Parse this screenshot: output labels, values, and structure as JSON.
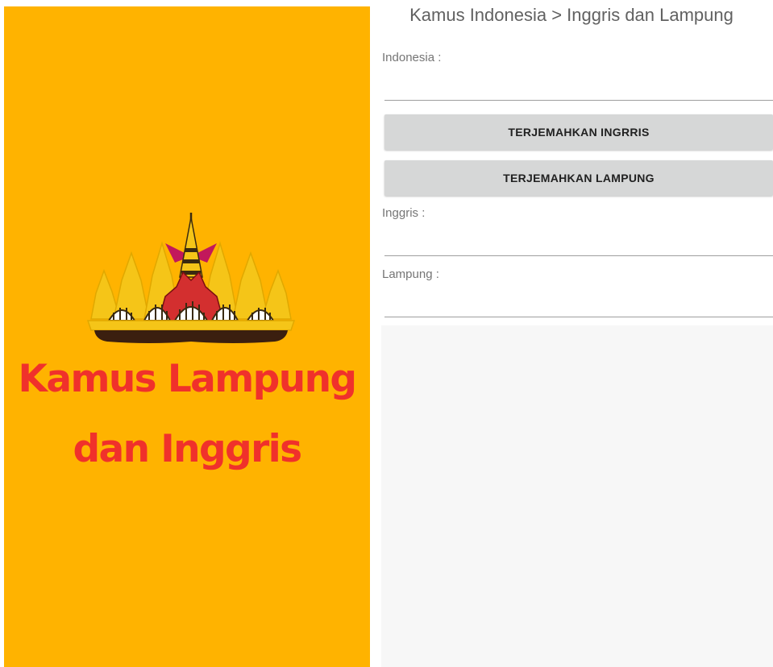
{
  "splash": {
    "title_line1": "Kamus Lampung",
    "title_line2": "dan Inggris",
    "background_color": "#FFB300",
    "title_color": "#F0312B",
    "logo_icon": "siger-crown-icon"
  },
  "app": {
    "title": "Kamus Indonesia > Inggris dan Lampung",
    "indonesia": {
      "label": "Indonesia :",
      "value": ""
    },
    "buttons": {
      "translate_english": "TERJEMAHKAN INGRRIS",
      "translate_lampung": "TERJEMAHKAN LAMPUNG"
    },
    "inggris": {
      "label": "Inggris :",
      "value": ""
    },
    "lampung": {
      "label": "Lampung :",
      "value": ""
    },
    "button_color": "#D6D7D7"
  }
}
